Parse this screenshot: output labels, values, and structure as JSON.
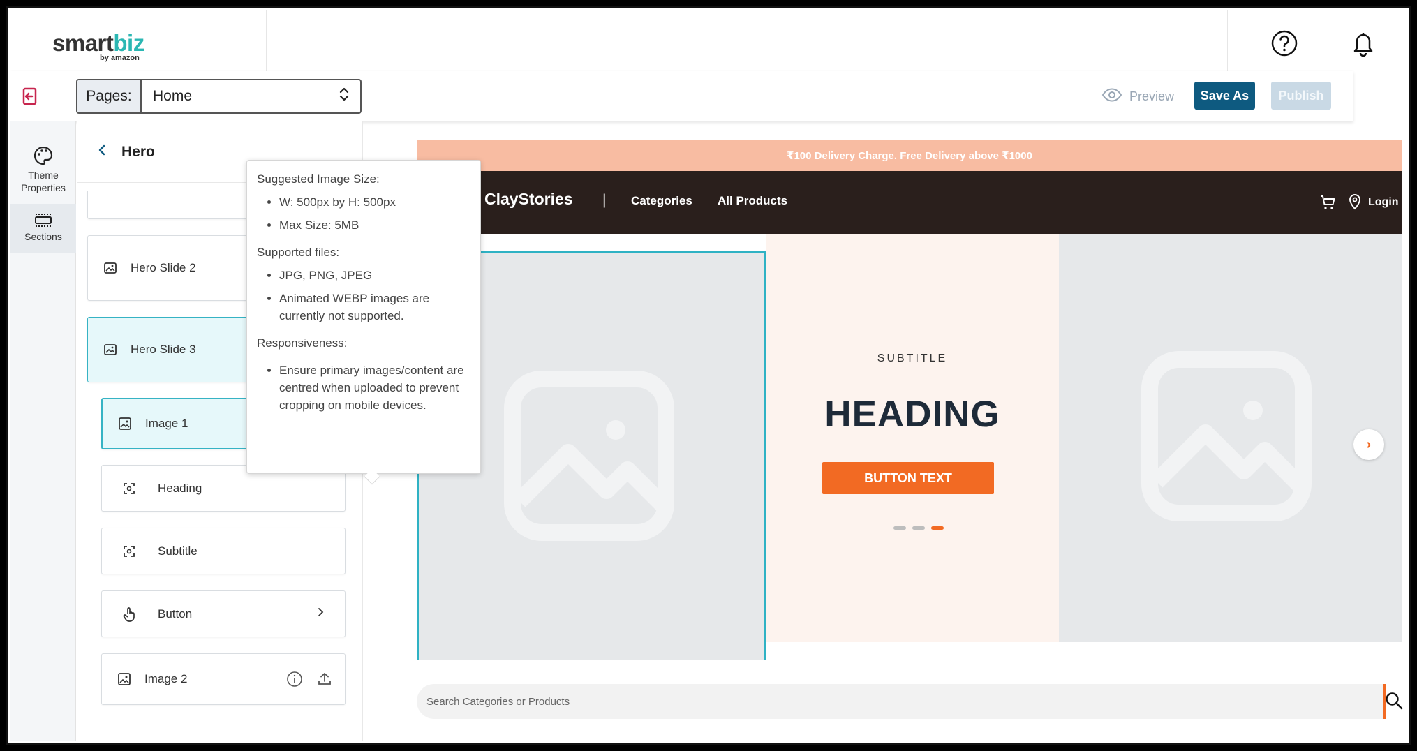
{
  "header": {
    "logo_main": "smart",
    "logo_accent": "biz",
    "logo_sub": "by amazon"
  },
  "toolbar": {
    "pages_label": "Pages:",
    "pages_value": "Home",
    "preview_label": "Preview",
    "save_as_label": "Save As",
    "publish_label": "Publish"
  },
  "rail": {
    "theme_label_1": "Theme",
    "theme_label_2": "Properties",
    "sections_label": "Sections"
  },
  "panel": {
    "title": "Hero",
    "items": [
      {
        "label": "Hero Slide 2"
      },
      {
        "label": "Hero Slide 3"
      },
      {
        "label": "Image 1"
      },
      {
        "label": "Heading"
      },
      {
        "label": "Subtitle"
      },
      {
        "label": "Button"
      },
      {
        "label": "Image 2"
      }
    ]
  },
  "tooltip": {
    "size_heading": "Suggested Image Size:",
    "size_items": [
      "W: 500px by H: 500px",
      "Max Size: 5MB"
    ],
    "files_heading": "Supported files:",
    "files_items": [
      "JPG, PNG, JPEG",
      "Animated WEBP images are currently not supported."
    ],
    "resp_heading": "Responsiveness:",
    "resp_items": [
      "Ensure primary images/content are centred when uploaded to prevent cropping on mobile devices."
    ]
  },
  "store": {
    "promo": "₹100 Delivery Charge. Free Delivery above ₹1000",
    "brand": "ClayStories",
    "nav_separator": "|",
    "nav_categories": "Categories",
    "nav_all_products": "All Products",
    "login": "Login",
    "hero_subtitle": "SUBTITLE",
    "hero_heading": "HEADING",
    "hero_button": "BUTTON TEXT",
    "search_placeholder": "Search Categories or Products",
    "next_arrow": "›"
  },
  "colors": {
    "accent_orange": "#f26a23",
    "primary_blue": "#0e5a80",
    "teal": "#2bb7b3",
    "promo_bg": "#f8bca2",
    "nav_bg": "#2a1f1c"
  }
}
